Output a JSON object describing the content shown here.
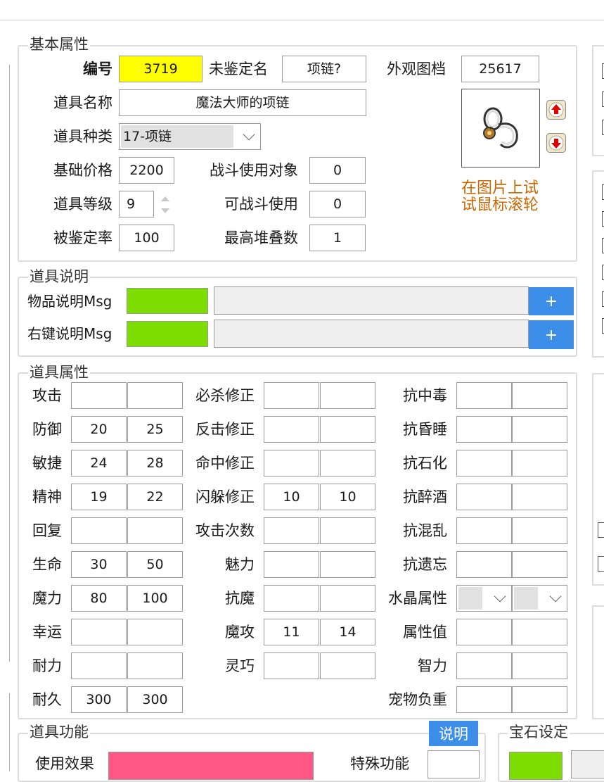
{
  "basic": {
    "legend": "基本属性",
    "id_label": "编号",
    "id_value": "3719",
    "unid_label": "未鉴定名",
    "unid_value": "项链?",
    "look_label": "外观图档",
    "look_value": "25617",
    "name_label": "道具名称",
    "name_value": "魔法大师的项链",
    "type_label": "道具种类",
    "type_value": "17-项链",
    "price_label": "基础价格",
    "price_value": "2200",
    "battle_target_label": "战斗使用对象",
    "battle_target_value": "0",
    "level_label": "道具等级",
    "level_value": "9",
    "battle_use_label": "可战斗使用",
    "battle_use_value": "0",
    "ident_label": "被鉴定率",
    "ident_value": "100",
    "stack_label": "最高堆叠数",
    "stack_value": "1",
    "hint_line1": "在图片上试",
    "hint_line2": "试鼠标滚轮"
  },
  "desc": {
    "legend": "道具说明",
    "item_msg_label": "物品说明Msg",
    "right_msg_label": "右键说明Msg",
    "plus": "+"
  },
  "attrs": {
    "legend": "道具属性",
    "col1": [
      {
        "label": "攻击",
        "a": "",
        "b": ""
      },
      {
        "label": "防御",
        "a": "20",
        "b": "25"
      },
      {
        "label": "敏捷",
        "a": "24",
        "b": "28"
      },
      {
        "label": "精神",
        "a": "19",
        "b": "22"
      },
      {
        "label": "回复",
        "a": "",
        "b": ""
      },
      {
        "label": "生命",
        "a": "30",
        "b": "50"
      },
      {
        "label": "魔力",
        "a": "80",
        "b": "100"
      },
      {
        "label": "幸运",
        "a": "",
        "b": ""
      },
      {
        "label": "耐力",
        "a": "",
        "b": ""
      },
      {
        "label": "耐久",
        "a": "300",
        "b": "300"
      }
    ],
    "col2": [
      {
        "label": "必杀修正",
        "a": "",
        "b": ""
      },
      {
        "label": "反击修正",
        "a": "",
        "b": ""
      },
      {
        "label": "命中修正",
        "a": "",
        "b": ""
      },
      {
        "label": "闪躲修正",
        "a": "10",
        "b": "10"
      },
      {
        "label": "攻击次数",
        "a": "",
        "b": ""
      },
      {
        "label": "魅力",
        "a": "",
        "b": ""
      },
      {
        "label": "抗魔",
        "a": "",
        "b": ""
      },
      {
        "label": "魔攻",
        "a": "11",
        "b": "14"
      },
      {
        "label": "灵巧",
        "a": "",
        "b": ""
      }
    ],
    "col3": [
      {
        "label": "抗中毒",
        "a": "",
        "b": ""
      },
      {
        "label": "抗昏睡",
        "a": "",
        "b": ""
      },
      {
        "label": "抗石化",
        "a": "",
        "b": ""
      },
      {
        "label": "抗醉酒",
        "a": "",
        "b": ""
      },
      {
        "label": "抗混乱",
        "a": "",
        "b": ""
      },
      {
        "label": "抗遗忘",
        "a": "",
        "b": ""
      },
      {
        "label": "水晶属性",
        "a": "",
        "b": ""
      },
      {
        "label": "属性值",
        "a": "",
        "b": ""
      },
      {
        "label": "智力",
        "a": "",
        "b": ""
      },
      {
        "label": "宠物负重",
        "a": "",
        "b": ""
      }
    ]
  },
  "func": {
    "legend": "道具功能",
    "help_button": "说明",
    "use_effect_label": "使用效果",
    "special_label": "特殊功能"
  },
  "gem": {
    "legend": "宝石设定"
  },
  "colors": {
    "yellow": "#ffff00",
    "green": "#7ddc00",
    "blue": "#3d8ee8",
    "pink": "#ff5685",
    "hint": "#cc6600"
  }
}
